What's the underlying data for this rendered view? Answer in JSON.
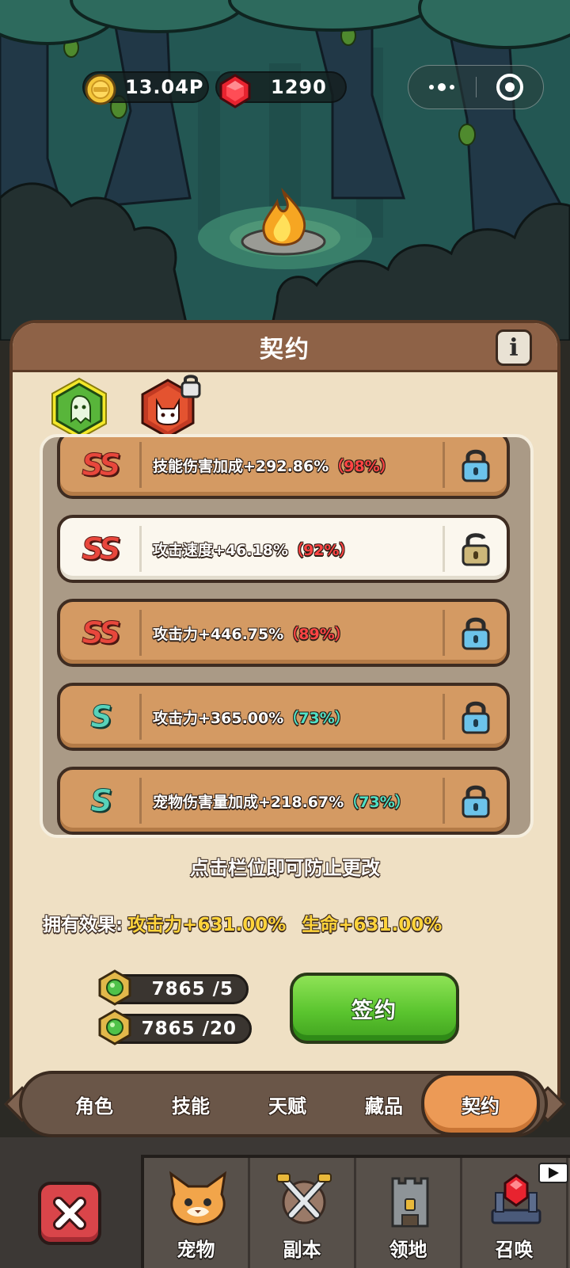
{
  "resources": {
    "gold": "13.04P",
    "gems": "1290"
  },
  "panel": {
    "title": "契约",
    "info_label": "i"
  },
  "contract_rows": [
    {
      "grade": "SS",
      "grade_class": "ss",
      "effect": "技能伤害加成+292.86%",
      "percent": "（98%）",
      "percent_class": "pct-red",
      "locked": true
    },
    {
      "grade": "SS",
      "grade_class": "ss",
      "effect": "攻击速度+46.18%",
      "percent": "（92%）",
      "percent_class": "pct-red",
      "locked": false,
      "selected": true
    },
    {
      "grade": "SS",
      "grade_class": "ss",
      "effect": "攻击力+446.75%",
      "percent": "（89%）",
      "percent_class": "pct-red",
      "locked": true
    },
    {
      "grade": "S",
      "grade_class": "s",
      "effect": "攻击力+365.00%",
      "percent": "（73%）",
      "percent_class": "pct-teal",
      "locked": true
    },
    {
      "grade": "S",
      "grade_class": "s",
      "effect": "宠物伤害量加成+218.67%",
      "percent": "（73%）",
      "percent_class": "pct-teal",
      "locked": true
    }
  ],
  "hint": "点击栏位即可防止更改",
  "effects": {
    "label": "拥有效果:",
    "attack": "攻击力+631.00%",
    "life": "生命+631.00%"
  },
  "costs": [
    "7865 /5",
    "7865 /20"
  ],
  "sign_button": "签约",
  "tabs": [
    "角色",
    "技能",
    "天赋",
    "藏品",
    "契约"
  ],
  "active_tab": "契约",
  "bottom_nav": [
    "宠物",
    "副本",
    "领地",
    "召唤"
  ],
  "colors": {
    "panel_bg": "#efe0c4",
    "row_bg": "#d49a63",
    "selected_row_bg": "#fbf7ee",
    "sign_green": "#5bc52f",
    "tab_active": "#ec9a56",
    "grade_ss": "#e8473c",
    "grade_s": "#58d2ba"
  },
  "icons": {
    "gold": "gold-coin-icon",
    "gem": "red-gem-icon",
    "lock": "padlock-icon",
    "close": "close-x-icon"
  }
}
